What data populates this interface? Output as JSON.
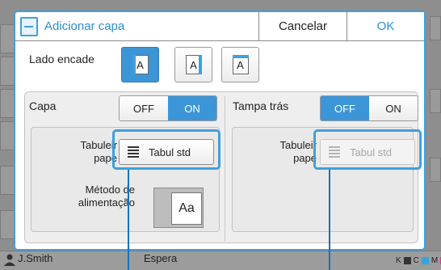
{
  "dialog": {
    "title": "Adicionar capa",
    "cancel_label": "Cancelar",
    "ok_label": "OK"
  },
  "binding_side": {
    "label": "Lado encade",
    "options": [
      {
        "glyph": "A",
        "binding": "left",
        "selected": true
      },
      {
        "glyph": "A",
        "binding": "right",
        "selected": false
      },
      {
        "glyph": "A",
        "binding": "top",
        "selected": false
      }
    ]
  },
  "front_cover": {
    "label": "Capa",
    "off_label": "OFF",
    "on_label": "ON",
    "state": "ON",
    "tray_label_line1": "Tabuleir",
    "tray_label_line2": "pape",
    "tray_value": "Tabul std",
    "feed_label_line1": "Método de",
    "feed_label_line2": "alimentação",
    "feed_preview_glyph": "Aa"
  },
  "back_cover": {
    "label": "Tampa trás",
    "off_label": "OFF",
    "on_label": "ON",
    "state": "OFF",
    "tray_label_line1": "Tabuleir",
    "tray_label_line2": "pape",
    "tray_value": "Tabul std"
  },
  "background": {
    "user_name": "J.Smith",
    "status": "Espera",
    "toner_labels": [
      "K",
      "C",
      "M",
      "Y"
    ]
  },
  "colors": {
    "accent": "#3fa0dc",
    "selected": "#3c95d6",
    "pointer": "#1f6fb3"
  }
}
